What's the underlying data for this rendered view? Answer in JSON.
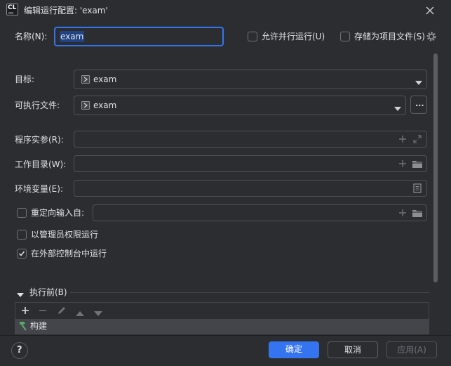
{
  "window": {
    "app_badge": "CL",
    "title": "编辑运行配置: 'exam'"
  },
  "name_row": {
    "label": "名称(N):",
    "value": "exam",
    "allow_parallel_label": "允许并行运行(U)",
    "store_as_project_label": "存储为项目文件(S)"
  },
  "target": {
    "label": "目标:",
    "value": "exam"
  },
  "executable": {
    "label": "可执行文件:",
    "value": "exam",
    "browse_label": "..."
  },
  "program_args": {
    "label": "程序实参(R):",
    "value": ""
  },
  "working_dir": {
    "label": "工作目录(W):",
    "value": ""
  },
  "env_vars": {
    "label": "环境变量(E):",
    "value": ""
  },
  "redirect_input": {
    "label": "重定向输入自:",
    "value": "",
    "checked": false
  },
  "run_as_admin": {
    "label": "以管理员权限运行",
    "checked": false
  },
  "run_in_console": {
    "label": "在外部控制台中运行",
    "checked": true
  },
  "before_launch": {
    "section_label": "执行前(B)",
    "items": [
      {
        "label": "构建"
      }
    ]
  },
  "footer": {
    "ok_label": "确定",
    "cancel_label": "取消",
    "apply_label": "应用(A)",
    "help_label": "?"
  },
  "colors": {
    "accent": "#3574f0",
    "focus_ring": "#3574f0",
    "background": "#2b2d30",
    "border": "#4e5157"
  }
}
